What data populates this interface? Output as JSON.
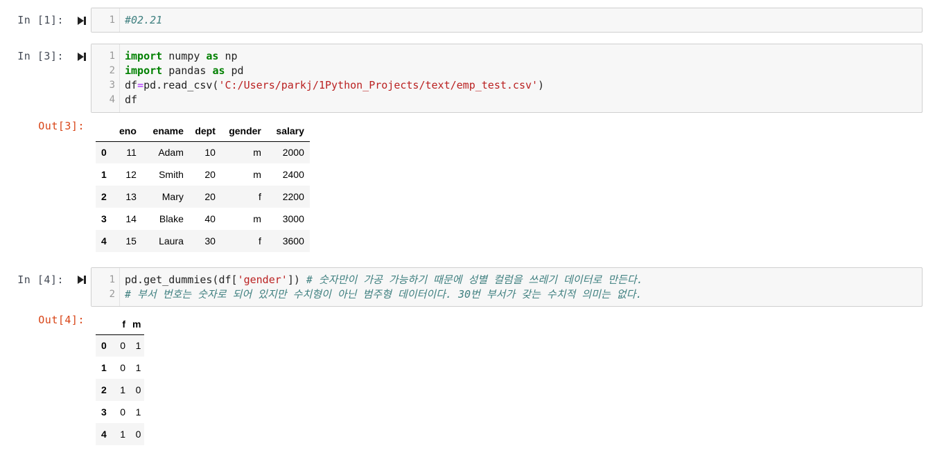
{
  "cells": [
    {
      "prompt": "In [1]:",
      "lines": [
        {
          "n": "1",
          "tokens": [
            {
              "t": "#02.21",
              "c": "cmt"
            }
          ]
        }
      ]
    },
    {
      "prompt": "In [3]:",
      "lines": [
        {
          "n": "1",
          "tokens": [
            {
              "t": "import",
              "c": "kw"
            },
            {
              "t": " numpy ",
              "c": ""
            },
            {
              "t": "as",
              "c": "kw"
            },
            {
              "t": " np",
              "c": ""
            }
          ]
        },
        {
          "n": "2",
          "tokens": [
            {
              "t": "import",
              "c": "kw"
            },
            {
              "t": " pandas ",
              "c": ""
            },
            {
              "t": "as",
              "c": "kw"
            },
            {
              "t": " pd",
              "c": ""
            }
          ]
        },
        {
          "n": "3",
          "tokens": [
            {
              "t": "df",
              "c": ""
            },
            {
              "t": "=",
              "c": "op"
            },
            {
              "t": "pd.read_csv(",
              "c": ""
            },
            {
              "t": "'C:/Users/parkj/1Python_Projects/text/emp_test.csv'",
              "c": "str"
            },
            {
              "t": ")",
              "c": ""
            }
          ]
        },
        {
          "n": "4",
          "tokens": [
            {
              "t": "df",
              "c": ""
            }
          ]
        }
      ],
      "out_prompt": "Out[3]:",
      "table": {
        "columns": [
          "eno",
          "ename",
          "dept",
          "gender",
          "salary"
        ],
        "rows": [
          {
            "index": "0",
            "values": [
              "11",
              "Adam",
              "10",
              "m",
              "2000"
            ]
          },
          {
            "index": "1",
            "values": [
              "12",
              "Smith",
              "20",
              "m",
              "2400"
            ]
          },
          {
            "index": "2",
            "values": [
              "13",
              "Mary",
              "20",
              "f",
              "2200"
            ]
          },
          {
            "index": "3",
            "values": [
              "14",
              "Blake",
              "40",
              "m",
              "3000"
            ]
          },
          {
            "index": "4",
            "values": [
              "15",
              "Laura",
              "30",
              "f",
              "3600"
            ]
          }
        ]
      }
    },
    {
      "prompt": "In [4]:",
      "lines": [
        {
          "n": "1",
          "tokens": [
            {
              "t": "pd.get_dummies(df[",
              "c": ""
            },
            {
              "t": "'gender'",
              "c": "str"
            },
            {
              "t": "]) ",
              "c": ""
            },
            {
              "t": "# 숫자만이 가공 가능하기 때문에 성별 컬럼을 쓰레기 데이터로 만든다.",
              "c": "cmt"
            }
          ]
        },
        {
          "n": "2",
          "tokens": [
            {
              "t": "# 부서 번호는 숫자로 되어 있지만 수치형이 아닌 범주형 데이터이다. 30번 부서가 갖는 수치적 의미는 없다.",
              "c": "cmt"
            }
          ]
        }
      ],
      "out_prompt": "Out[4]:",
      "table": {
        "columns": [
          "f",
          "m"
        ],
        "rows": [
          {
            "index": "0",
            "values": [
              "0",
              "1"
            ]
          },
          {
            "index": "1",
            "values": [
              "0",
              "1"
            ]
          },
          {
            "index": "2",
            "values": [
              "1",
              "0"
            ]
          },
          {
            "index": "3",
            "values": [
              "0",
              "1"
            ]
          },
          {
            "index": "4",
            "values": [
              "1",
              "0"
            ]
          }
        ]
      }
    }
  ]
}
